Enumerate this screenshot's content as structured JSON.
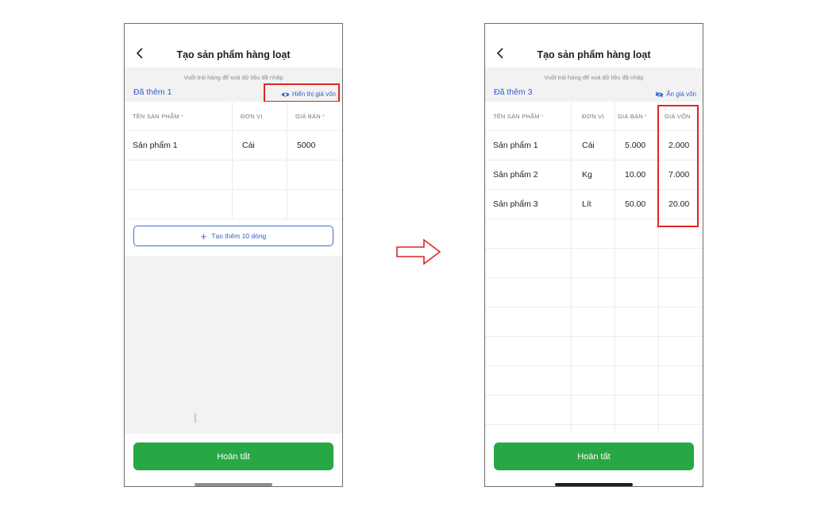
{
  "left_screen": {
    "header_title": "Tạo sản phẩm hàng loạt",
    "hint": "Vuốt trái hàng để xoá dữ liệu đã nhập",
    "added_count": "Đã thêm 1",
    "toggle_cost_label": "Hiển thị giá vốn",
    "columns": [
      "TÊN SẢN PHẨM",
      "ĐƠN VỊ",
      "GIÁ BÁN"
    ],
    "rows": [
      [
        "Sản phẩm 1",
        "Cái",
        "5000"
      ],
      [
        "",
        "",
        ""
      ],
      [
        "",
        "",
        ""
      ]
    ],
    "add_rows_label": "Tạo thêm 10 dòng",
    "done_label": "Hoàn tất"
  },
  "right_screen": {
    "header_title": "Tạo sản phẩm hàng loạt",
    "hint": "Vuốt trái hàng để xoá dữ liệu đã nhập",
    "added_count": "Đã thêm 3",
    "toggle_cost_label": "Ẩn giá vốn",
    "columns": [
      "TÊN SẢN PHẨM",
      "ĐƠN VỊ",
      "GIÁ BÁN",
      "GIÁ VỐN"
    ],
    "rows": [
      [
        "Sản phẩm 1",
        "Cái",
        "5.000",
        "2.000"
      ],
      [
        "Sản phẩm 2",
        "Kg",
        "10.00",
        "7.000"
      ],
      [
        "Sản phẩm 3",
        "Lít",
        "50.00",
        "20.00"
      ],
      [
        "",
        "",
        "",
        ""
      ],
      [
        "",
        "",
        "",
        ""
      ],
      [
        "",
        "",
        "",
        ""
      ],
      [
        "",
        "",
        "",
        ""
      ],
      [
        "",
        "",
        "",
        ""
      ],
      [
        "",
        "",
        "",
        ""
      ],
      [
        "",
        "",
        "",
        ""
      ],
      [
        "",
        "",
        "",
        ""
      ]
    ],
    "done_label": "Hoàn tất"
  },
  "colors": {
    "accent_blue": "#2f5fd0",
    "done_green": "#28a745",
    "highlight_red": "#e02424",
    "required_mark": "#e8a23a"
  },
  "icons": {
    "back": "chevron-left-icon",
    "eye": "eye-icon",
    "plus": "plus-icon",
    "arrow": "right-arrow-icon"
  }
}
